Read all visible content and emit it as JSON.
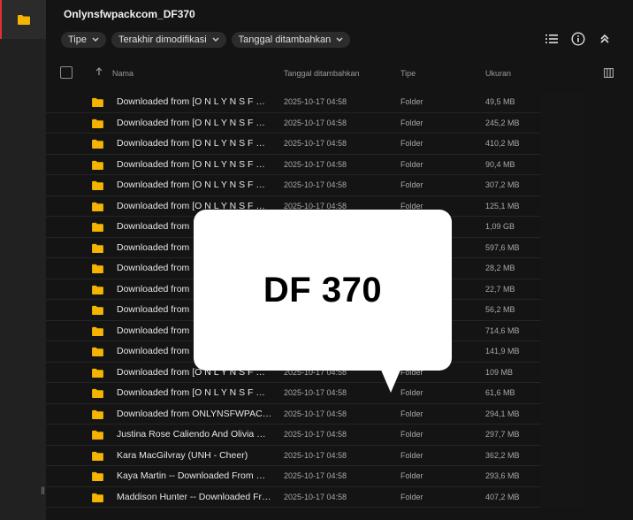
{
  "window": {
    "folder_title": "Onlynsfwpackcom_DF370"
  },
  "filters": [
    {
      "label": "Tipe"
    },
    {
      "label": "Terakhir dimodifikasi"
    },
    {
      "label": "Tanggal ditambahkan"
    }
  ],
  "columns": {
    "name": "Nama",
    "date": "Tanggal ditambahkan",
    "type": "Tipe",
    "size": "Ukuran"
  },
  "rows": [
    {
      "name": "Downloaded from [O N L Y N S F W P A C K . C O M]",
      "date": "2025-10-17 04:58",
      "type": "Folder",
      "size": "49,5 MB"
    },
    {
      "name": "Downloaded from [O N L Y N S F W P A C K . C O M]",
      "date": "2025-10-17 04:58",
      "type": "Folder",
      "size": "245,2 MB"
    },
    {
      "name": "Downloaded from [O N L Y N S F W P A C K . C O M]",
      "date": "2025-10-17 04:58",
      "type": "Folder",
      "size": "410,2 MB"
    },
    {
      "name": "Downloaded from [O N L Y N S F W P A C K . C O M]",
      "date": "2025-10-17 04:58",
      "type": "Folder",
      "size": "90,4 MB"
    },
    {
      "name": "Downloaded from [O N L Y N S F W P A C K . C O M]",
      "date": "2025-10-17 04:58",
      "type": "Folder",
      "size": "307,2 MB"
    },
    {
      "name": "Downloaded from [O N L Y N S F W P A C K . C O M]",
      "date": "2025-10-17 04:58",
      "type": "Folder",
      "size": "125,1 MB"
    },
    {
      "name": "Downloaded from",
      "date": "",
      "type": "",
      "size": "1,09 GB"
    },
    {
      "name": "Downloaded from",
      "date": "",
      "type": "",
      "size": "597,6 MB"
    },
    {
      "name": "Downloaded from",
      "date": "",
      "type": "",
      "size": "28,2 MB"
    },
    {
      "name": "Downloaded from",
      "date": "",
      "type": "",
      "size": "22,7 MB"
    },
    {
      "name": "Downloaded from",
      "date": "",
      "type": "",
      "size": "56,2 MB"
    },
    {
      "name": "Downloaded from",
      "date": "",
      "type": "",
      "size": "714,6 MB"
    },
    {
      "name": "Downloaded from",
      "date": "",
      "type": "",
      "size": "141,9 MB"
    },
    {
      "name": "Downloaded from [O N L Y N S F W P A C K . C O M]",
      "date": "2025-10-17 04:58",
      "type": "Folder",
      "size": "109 MB"
    },
    {
      "name": "Downloaded from [O N L Y N S F W P A C K . C O M]",
      "date": "2025-10-17 04:58",
      "type": "Folder",
      "size": "61,6 MB"
    },
    {
      "name": "Downloaded from ONLYNSFWPACK.COM",
      "date": "2025-10-17 04:58",
      "type": "Folder",
      "size": "294,1 MB"
    },
    {
      "name": "Justina Rose Caliendo And Olivia Rose",
      "date": "2025-10-17 04:58",
      "type": "Folder",
      "size": "297,7 MB"
    },
    {
      "name": "Kara MacGilvray (UNH - Cheer)",
      "date": "2025-10-17 04:58",
      "type": "Folder",
      "size": "362,2 MB"
    },
    {
      "name": "Kaya Martin -- Downloaded From ONLYNSFWPACK",
      "date": "2025-10-17 04:58",
      "type": "Folder",
      "size": "293,6 MB"
    },
    {
      "name": "Maddison Hunter -- Downloaded From ONLYNSFWPACK",
      "date": "2025-10-17 04:58",
      "type": "Folder",
      "size": "407,2 MB"
    }
  ],
  "overlay": {
    "text": "DF 370"
  },
  "colors": {
    "folder": "#f5b400",
    "accent_red": "#e03131",
    "background": "#141414"
  },
  "icons": [
    "folder-icon",
    "list-view-icon",
    "info-icon",
    "collapse-icon",
    "sort-up-arrow-icon",
    "column-settings-icon"
  ]
}
